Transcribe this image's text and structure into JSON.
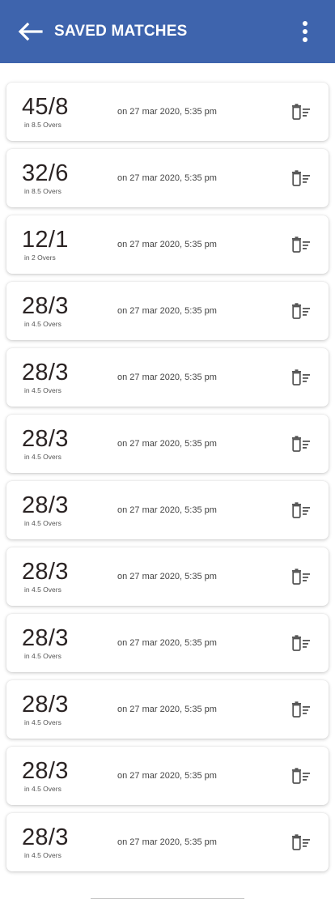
{
  "header": {
    "title": "SAVED MATCHES",
    "background": "#3e64ad",
    "back_icon": "arrow-left-icon",
    "menu_icon": "more-vert-icon"
  },
  "matches": [
    {
      "score": "45/8",
      "overs": "in 8.5 Overs",
      "date": "on 27 mar 2020, 5:35 pm"
    },
    {
      "score": "32/6",
      "overs": "in 8.5 Overs",
      "date": "on 27 mar 2020, 5:35 pm"
    },
    {
      "score": "12/1",
      "overs": "in 2 Overs",
      "date": "on 27 mar 2020, 5:35 pm"
    },
    {
      "score": "28/3",
      "overs": "in 4.5 Overs",
      "date": "on 27 mar 2020, 5:35 pm"
    },
    {
      "score": "28/3",
      "overs": "in 4.5 Overs",
      "date": "on 27 mar 2020, 5:35 pm"
    },
    {
      "score": "28/3",
      "overs": "in 4.5 Overs",
      "date": "on 27 mar 2020, 5:35 pm"
    },
    {
      "score": "28/3",
      "overs": "in 4.5 Overs",
      "date": "on 27 mar 2020, 5:35 pm"
    },
    {
      "score": "28/3",
      "overs": "in 4.5 Overs",
      "date": "on 27 mar 2020, 5:35 pm"
    },
    {
      "score": "28/3",
      "overs": "in 4.5 Overs",
      "date": "on 27 mar 2020, 5:35 pm"
    },
    {
      "score": "28/3",
      "overs": "in 4.5 Overs",
      "date": "on 27 mar 2020, 5:35 pm"
    },
    {
      "score": "28/3",
      "overs": "in 4.5 Overs",
      "date": "on 27 mar 2020, 5:35 pm"
    },
    {
      "score": "28/3",
      "overs": "in 4.5 Overs",
      "date": "on 27 mar 2020, 5:35 pm"
    }
  ],
  "row_icon": "delete-sweep-icon"
}
